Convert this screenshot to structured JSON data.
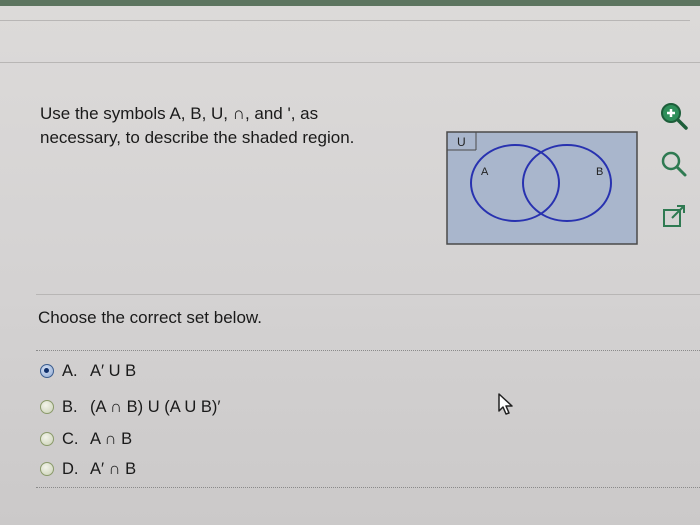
{
  "question": {
    "prompt_line1": "Use the symbols A, B, U, ∩, and ', as",
    "prompt_line2": "necessary, to describe the shaded region."
  },
  "venn": {
    "universe_label": "U",
    "set_a_label": "A",
    "set_b_label": "B",
    "shaded_color": "#a9b6cc",
    "circle_color": "#2832b0"
  },
  "tools": {
    "icons": [
      "zoom-in-icon",
      "zoom-out-icon",
      "popout-icon"
    ]
  },
  "instructions": {
    "choose_text": "Choose the correct set below."
  },
  "choices": [
    {
      "letter": "A.",
      "text": "A′ U B",
      "selected": true
    },
    {
      "letter": "B.",
      "text": "(A ∩ B) U (A U B)′",
      "selected": false
    },
    {
      "letter": "C.",
      "text": "A ∩ B",
      "selected": false
    },
    {
      "letter": "D.",
      "text": "A′ ∩ B",
      "selected": false
    }
  ]
}
